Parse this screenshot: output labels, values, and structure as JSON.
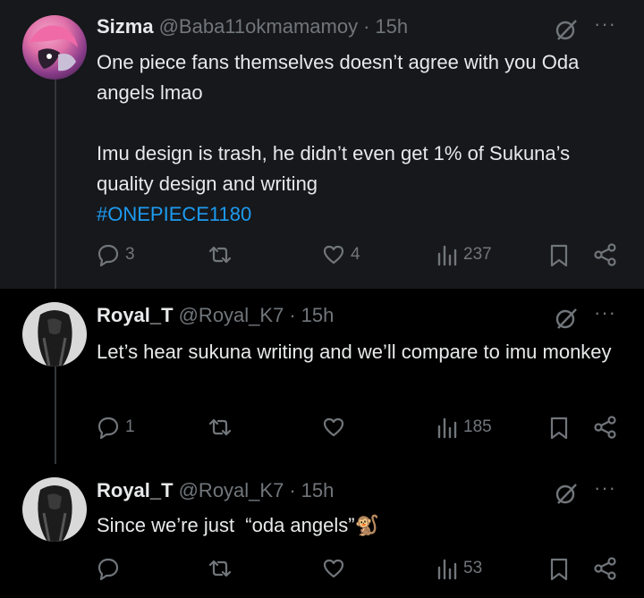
{
  "tweets": [
    {
      "name": "Sizma",
      "handle": "@Baba11okmamamoy",
      "time": "15h",
      "body_text": "One piece fans themselves doesn’t agree with you Oda angels lmao\n\nImu design is trash, he didn’t even get 1% of Sukuna’s quality design and writing\n",
      "hashtag": "#ONEPIECE1180",
      "replies": "3",
      "reposts": "",
      "likes": "4",
      "views": "237"
    },
    {
      "name": "Royal_T",
      "handle": "@Royal_K7",
      "time": "15h",
      "body_text": "Let’s hear sukuna writing and we’ll compare to imu monkey",
      "replies": "1",
      "reposts": "",
      "likes": "",
      "views": "185"
    },
    {
      "name": "Royal_T",
      "handle": "@Royal_K7",
      "time": "15h",
      "body_text": "Since we’re just  “oda angels”🐒",
      "replies": "",
      "reposts": "",
      "likes": "",
      "views": "53"
    }
  ],
  "separator": "·",
  "colors": {
    "background": "#000000",
    "highlight_background": "#16181c",
    "text": "#e7e9ea",
    "muted": "#71767b",
    "link": "#1d9bf0"
  },
  "icons": [
    "reply-icon",
    "repost-icon",
    "like-icon",
    "views-icon",
    "bookmark-icon",
    "share-icon",
    "grok-icon",
    "more-icon"
  ]
}
